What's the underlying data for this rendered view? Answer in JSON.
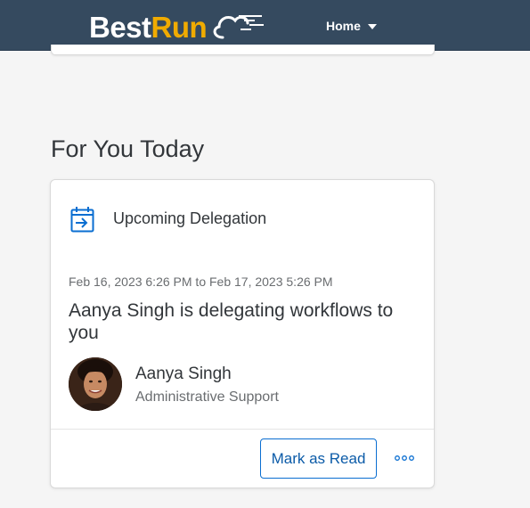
{
  "header": {
    "logo_part1": "Best",
    "logo_part2": "Run",
    "nav_menu_label": "Home",
    "colors": {
      "bar": "#354a5f",
      "logo_accent": "#f0ab00"
    }
  },
  "section": {
    "title": "For You Today"
  },
  "card": {
    "icon": "calendar-delegation-icon",
    "title": "Upcoming Delegation",
    "date_range": "Feb 16, 2023 6:26 PM to Feb 17, 2023 5:26 PM",
    "headline": "Aanya Singh is delegating workflows to you",
    "person": {
      "name": "Aanya Singh",
      "role": "Administrative Support"
    },
    "actions": {
      "mark_read_label": "Mark as Read",
      "more_icon": "overflow-dots-icon"
    },
    "accent_color": "#0a6ed1"
  }
}
